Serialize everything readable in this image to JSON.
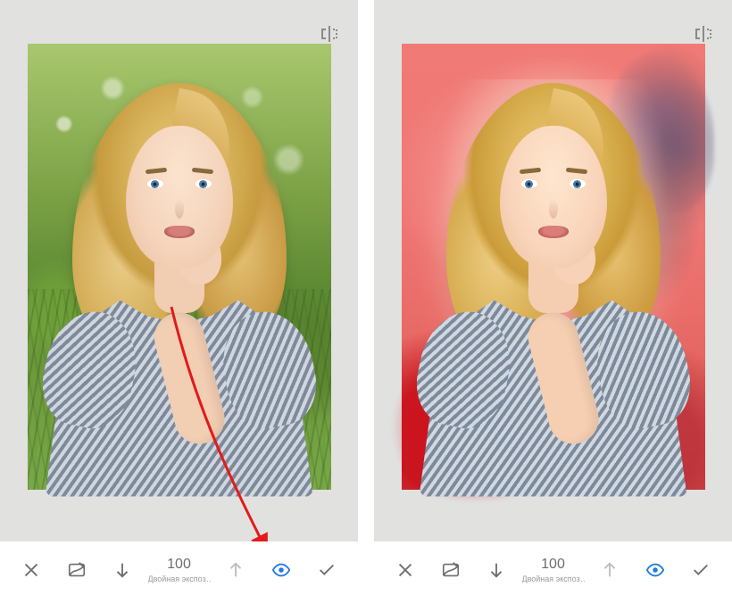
{
  "panes": {
    "left": {
      "compare_icon": "compare-icon",
      "toolbar": {
        "cancel_icon": "close-icon",
        "mask_icon": "mask-brush-icon",
        "undo_icon": "undo-arrow-down-icon",
        "value": "100",
        "value_label": "Двойная экспоз…",
        "redo_icon": "redo-arrow-up-icon",
        "preview_icon": "eye-icon",
        "apply_icon": "check-icon"
      }
    },
    "right": {
      "compare_icon": "compare-icon",
      "toolbar": {
        "cancel_icon": "close-icon",
        "mask_icon": "mask-brush-icon",
        "undo_icon": "undo-arrow-down-icon",
        "value": "100",
        "value_label": "Двойная экспоз…",
        "redo_icon": "redo-arrow-up-icon",
        "preview_icon": "eye-icon",
        "apply_icon": "check-icon"
      }
    }
  },
  "annotation": {
    "arrow_color": "#e21b1b"
  }
}
